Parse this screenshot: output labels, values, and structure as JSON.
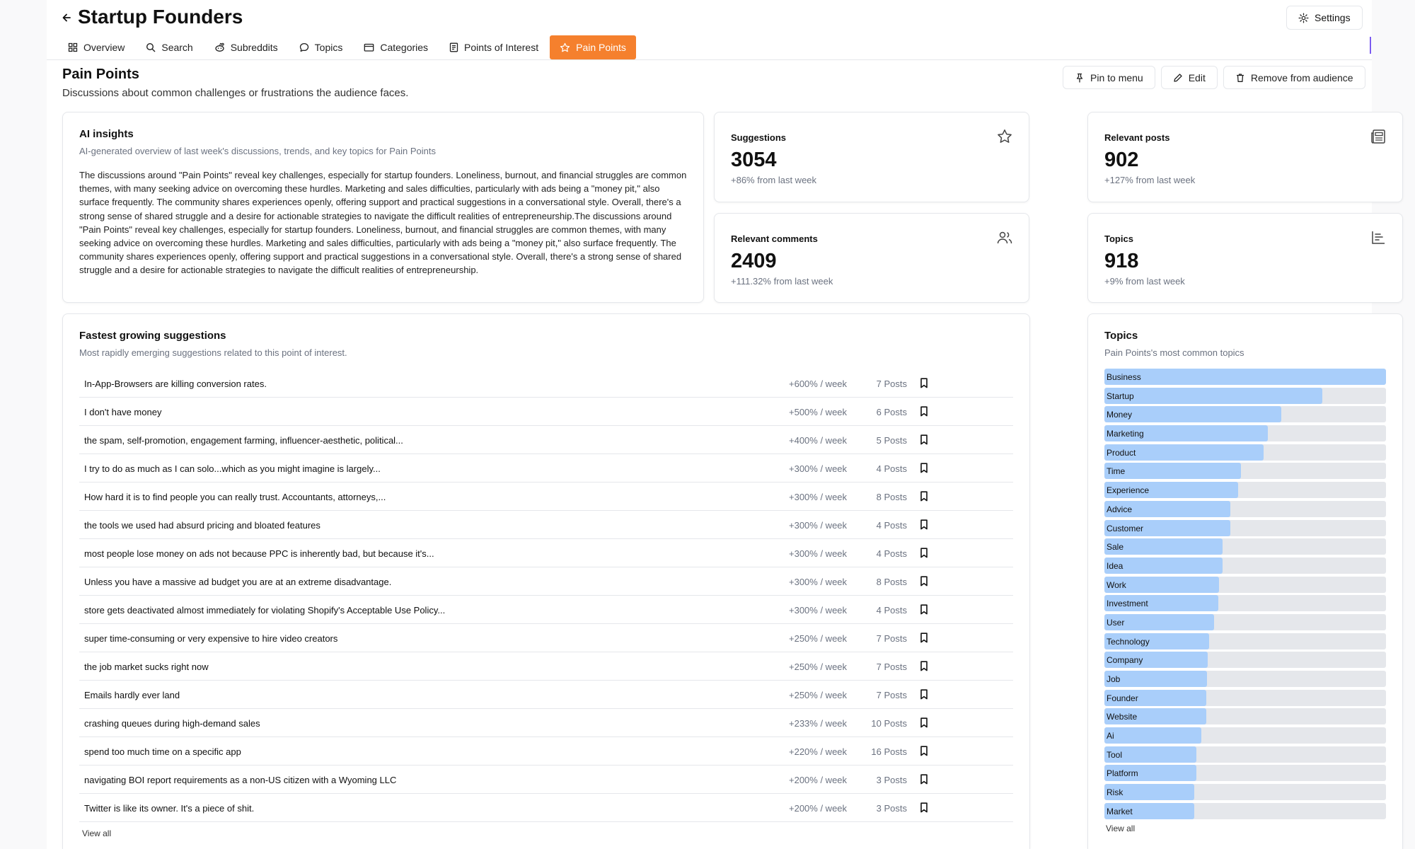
{
  "app": {
    "title": "Startup Founders",
    "settings_label": "Settings"
  },
  "tabs": [
    {
      "label": "Overview",
      "icon": "grid-icon"
    },
    {
      "label": "Search",
      "icon": "search-icon"
    },
    {
      "label": "Subreddits",
      "icon": "reddit-icon"
    },
    {
      "label": "Topics",
      "icon": "chat-icon"
    },
    {
      "label": "Categories",
      "icon": "folder-icon"
    },
    {
      "label": "Points of Interest",
      "icon": "document-icon"
    },
    {
      "label": "Pain Points",
      "icon": "star-icon",
      "active": true
    }
  ],
  "section": {
    "title": "Pain Points",
    "subtitle": "Discussions about common challenges or frustrations the audience faces."
  },
  "actions": {
    "pin": "Pin to menu",
    "edit": "Edit",
    "remove": "Remove from audience"
  },
  "ai_insights": {
    "title": "AI insights",
    "subtitle": "AI-generated overview of last week's discussions, trends, and key topics for Pain Points",
    "body": "The discussions around \"Pain Points\" reveal key challenges, especially for startup founders. Loneliness, burnout, and financial struggles are common themes, with many seeking advice on overcoming these hurdles. Marketing and sales difficulties, particularly with ads being a \"money pit,\" also surface frequently. The community shares experiences openly, offering support and practical suggestions in a conversational style. Overall, there's a strong sense of shared struggle and a desire for actionable strategies to navigate the difficult realities of entrepreneurship.The discussions around \"Pain Points\" reveal key challenges, especially for startup founders. Loneliness, burnout, and financial struggles are common themes, with many seeking advice on overcoming these hurdles. Marketing and sales difficulties, particularly with ads being a \"money pit,\" also surface frequently. The community shares experiences openly, offering support and practical suggestions in a conversational style. Overall, there's a strong sense of shared struggle and a desire for actionable strategies to navigate the difficult realities of entrepreneurship."
  },
  "stats": {
    "suggestions": {
      "title": "Suggestions",
      "value": "3054",
      "change": "+86% from last week"
    },
    "posts": {
      "title": "Relevant posts",
      "value": "902",
      "change": "+127% from last week"
    },
    "comments": {
      "title": "Relevant comments",
      "value": "2409",
      "change": "+111.32% from last week"
    },
    "topics": {
      "title": "Topics",
      "value": "918",
      "change": "+9% from last week"
    }
  },
  "fastest": {
    "title": "Fastest growing suggestions",
    "subtitle": "Most rapidly emerging suggestions related to this point of interest.",
    "items": [
      {
        "text": "In-App-Browsers are killing conversion rates.",
        "growth": "+600% / week",
        "posts": "7 Posts"
      },
      {
        "text": "I don't have money",
        "growth": "+500% / week",
        "posts": "6 Posts"
      },
      {
        "text": "the spam, self-promotion, engagement farming, influencer-aesthetic, political...",
        "growth": "+400% / week",
        "posts": "5 Posts"
      },
      {
        "text": "I try to do as much as I can solo...which as you might imagine is largely...",
        "growth": "+300% / week",
        "posts": "4 Posts"
      },
      {
        "text": "How hard it is to find people you can really trust. Accountants, attorneys,...",
        "growth": "+300% / week",
        "posts": "8 Posts"
      },
      {
        "text": "the tools we used had absurd pricing and bloated features",
        "growth": "+300% / week",
        "posts": "4 Posts"
      },
      {
        "text": "most people lose money on ads not because PPC is inherently bad, but because it's...",
        "growth": "+300% / week",
        "posts": "4 Posts"
      },
      {
        "text": "Unless you have a massive ad budget you are at an extreme disadvantage.",
        "growth": "+300% / week",
        "posts": "8 Posts"
      },
      {
        "text": "store gets deactivated almost immediately for violating Shopify's Acceptable Use Policy...",
        "growth": "+300% / week",
        "posts": "4 Posts"
      },
      {
        "text": "super time-consuming or very expensive to hire video creators",
        "growth": "+250% / week",
        "posts": "7 Posts"
      },
      {
        "text": "the job market sucks right now",
        "growth": "+250% / week",
        "posts": "7 Posts"
      },
      {
        "text": "Emails hardly ever land",
        "growth": "+250% / week",
        "posts": "7 Posts"
      },
      {
        "text": "crashing queues during high-demand sales",
        "growth": "+233% / week",
        "posts": "10 Posts"
      },
      {
        "text": "spend too much time on a specific app",
        "growth": "+220% / week",
        "posts": "16 Posts"
      },
      {
        "text": "navigating BOI report requirements as a non-US citizen with a Wyoming LLC",
        "growth": "+200% / week",
        "posts": "3 Posts"
      },
      {
        "text": "Twitter is like its owner. It's a piece of shit.",
        "growth": "+200% / week",
        "posts": "3 Posts"
      }
    ],
    "view_all": "View all"
  },
  "topics_panel": {
    "title": "Topics",
    "subtitle": "Pain Points's most common topics",
    "bar_color": "#a9cefa",
    "track_color": "#e5e7eb",
    "items": [
      {
        "label": "Business",
        "share": 1.0
      },
      {
        "label": "Startup",
        "share": 0.774
      },
      {
        "label": "Money",
        "share": 0.627
      },
      {
        "label": "Marketing",
        "share": 0.581
      },
      {
        "label": "Product",
        "share": 0.566
      },
      {
        "label": "Time",
        "share": 0.484
      },
      {
        "label": "Experience",
        "share": 0.474
      },
      {
        "label": "Advice",
        "share": 0.446
      },
      {
        "label": "Customer",
        "share": 0.446
      },
      {
        "label": "Sale",
        "share": 0.42
      },
      {
        "label": "Idea",
        "share": 0.42
      },
      {
        "label": "Work",
        "share": 0.408
      },
      {
        "label": "Investment",
        "share": 0.405
      },
      {
        "label": "User",
        "share": 0.389
      },
      {
        "label": "Technology",
        "share": 0.373
      },
      {
        "label": "Company",
        "share": 0.367
      },
      {
        "label": "Job",
        "share": 0.364
      },
      {
        "label": "Founder",
        "share": 0.361
      },
      {
        "label": "Website",
        "share": 0.361
      },
      {
        "label": "Ai",
        "share": 0.345
      },
      {
        "label": "Tool",
        "share": 0.326
      },
      {
        "label": "Platform",
        "share": 0.326
      },
      {
        "label": "Risk",
        "share": 0.32
      },
      {
        "label": "Market",
        "share": 0.32
      }
    ],
    "view_all": "View all"
  }
}
